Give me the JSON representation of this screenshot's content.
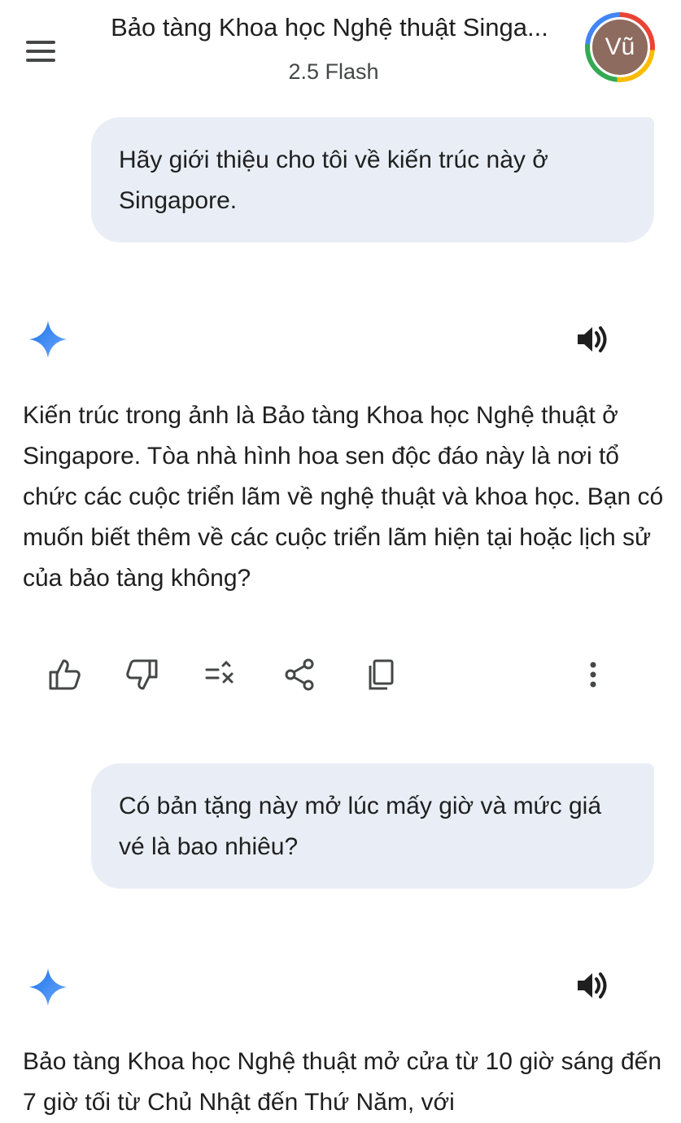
{
  "header": {
    "title": "Bảo tàng Khoa học Nghệ thuật Singa...",
    "model": "2.5 Flash",
    "avatar_initials": "Vũ"
  },
  "messages": [
    {
      "role": "user",
      "text": "Hãy giới thiệu cho tôi về kiến trúc này ở Singapore."
    },
    {
      "role": "model",
      "text": "Kiến trúc trong ảnh là Bảo tàng Khoa học Nghệ thuật ở Singapore. Tòa nhà hình hoa sen độc đáo này là nơi tổ chức các cuộc triển lãm về nghệ thuật và khoa học. Bạn có muốn biết thêm về các cuộc triển lãm hiện tại hoặc lịch sử của bảo tàng không?"
    },
    {
      "role": "user",
      "text": "Có bản tặng này mở lúc mấy giờ và mức giá vé là bao nhiêu?"
    },
    {
      "role": "model",
      "text": "Bảo tàng Khoa học Nghệ thuật mở cửa từ 10 giờ sáng đến 7 giờ tối từ Chủ Nhật đến Thứ Năm, với"
    }
  ],
  "icons": {
    "menu": "menu-icon",
    "gemini": "gemini-sparkle-icon",
    "speaker": "speaker-icon",
    "actions": [
      "thumbs-up-icon",
      "thumbs-down-icon",
      "modify-response-icon",
      "share-icon",
      "copy-icon",
      "more-vert-icon"
    ]
  },
  "colors": {
    "user_bubble": "#e9eef6",
    "text": "#1f1f1f",
    "secondary_text": "#444746",
    "gemini_blue": "#4285f4",
    "avatar_bg": "#8d6b5e"
  }
}
